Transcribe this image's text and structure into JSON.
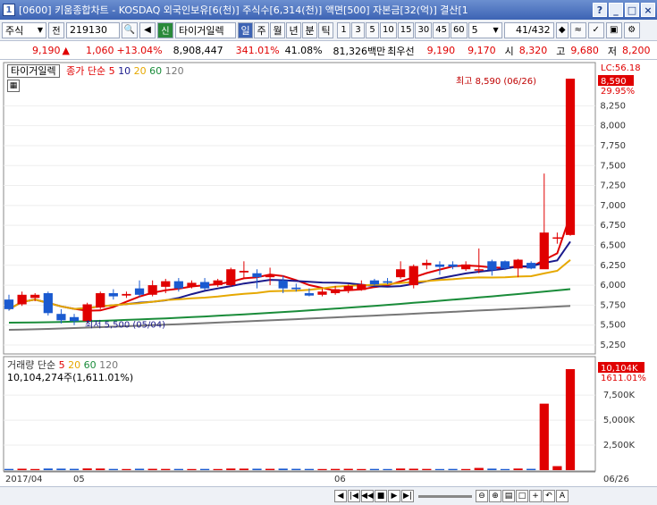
{
  "window": {
    "screen_no": "1",
    "title": "[0600] 키움종합차트 - KOSDAQ 외국인보유[6(천)] 주식수[6,314(천)] 액면[500] 자본금[32(억)] 결산[1",
    "help_label": "?",
    "minimize_label": "_",
    "maximize_label": "□",
    "close_label": "×"
  },
  "toolbar": {
    "market": "주식",
    "before_label": "전",
    "code": "219130",
    "stock_badge": "신",
    "stock_name": "타이거일렉",
    "periods": [
      "일",
      "주",
      "월",
      "년",
      "분",
      "틱"
    ],
    "active_period": "일",
    "intervals": [
      "1",
      "3",
      "5",
      "10",
      "15",
      "30",
      "45",
      "60"
    ],
    "count": "5",
    "page": "41",
    "page_total": "/432"
  },
  "quote": {
    "price": "9,190",
    "change_arrow": "▲",
    "change": "1,060",
    "change_pct": "+13.04%",
    "volume": "8,908,447",
    "vol_ratio": "341.01%",
    "turnover": "41.08%",
    "amount": "81,326백만",
    "seller": "최우선",
    "ask": "9,190",
    "bid": "9,170",
    "open_label": "시",
    "open": "8,320",
    "high_label": "고",
    "high": "9,680",
    "low_label": "저",
    "low": "8,200"
  },
  "price_panel": {
    "name_box": "타이거일렉",
    "ma_label": "종가 단순",
    "ma_periods": [
      "5",
      "10",
      "20",
      "60",
      "120"
    ],
    "ma_colors": [
      "#e00000",
      "#1a1a8c",
      "#e6a800",
      "#1a8c3a",
      "#777777"
    ],
    "high_annotation": "최고 8,590 (06/26)",
    "low_annotation": "최저 5,500 (05/04)",
    "current_tag": "8,590",
    "pct_tag": "29.95%",
    "lc_tag": "LC:56.18",
    "y_ticks": [
      "8,250",
      "8,000",
      "7,750",
      "7,500",
      "7,250",
      "7,000",
      "6,750",
      "6,500",
      "6,250",
      "6,000",
      "5,750",
      "5,500",
      "5,250"
    ]
  },
  "volume_panel": {
    "label": "거래량 단순",
    "ma_periods": [
      "5",
      "20",
      "60",
      "120"
    ],
    "value_text": "10,104,274주(1,611.01%)",
    "current_tag": "10,104K",
    "pct_tag": "1611.01%",
    "y_ticks": [
      "7,500K",
      "5,000K",
      "2,500K"
    ]
  },
  "x_axis": {
    "labels": [
      "2017/04",
      "05",
      "06",
      "06/26"
    ]
  },
  "chart_data": {
    "type": "candlestick",
    "title": "",
    "ylim": [
      5250,
      8590
    ],
    "candles": [
      {
        "o": 5820,
        "c": 5700,
        "h": 5880,
        "l": 5680
      },
      {
        "o": 5760,
        "c": 5880,
        "h": 5920,
        "l": 5740
      },
      {
        "o": 5840,
        "c": 5880,
        "h": 5900,
        "l": 5800
      },
      {
        "o": 5900,
        "c": 5650,
        "h": 5920,
        "l": 5620
      },
      {
        "o": 5640,
        "c": 5560,
        "h": 5700,
        "l": 5520
      },
      {
        "o": 5600,
        "c": 5550,
        "h": 5640,
        "l": 5500
      },
      {
        "o": 5550,
        "c": 5760,
        "h": 5780,
        "l": 5530
      },
      {
        "o": 5720,
        "c": 5900,
        "h": 5920,
        "l": 5700
      },
      {
        "o": 5900,
        "c": 5860,
        "h": 5950,
        "l": 5820
      },
      {
        "o": 5870,
        "c": 5890,
        "h": 5920,
        "l": 5840
      },
      {
        "o": 5960,
        "c": 5880,
        "h": 6060,
        "l": 5850
      },
      {
        "o": 5880,
        "c": 6000,
        "h": 6060,
        "l": 5860
      },
      {
        "o": 5980,
        "c": 6050,
        "h": 6080,
        "l": 5900
      },
      {
        "o": 6050,
        "c": 5960,
        "h": 6090,
        "l": 5920
      },
      {
        "o": 5980,
        "c": 6030,
        "h": 6060,
        "l": 5960
      },
      {
        "o": 6040,
        "c": 5960,
        "h": 6090,
        "l": 5940
      },
      {
        "o": 6000,
        "c": 6060,
        "h": 6080,
        "l": 5980
      },
      {
        "o": 6000,
        "c": 6200,
        "h": 6220,
        "l": 5980
      },
      {
        "o": 6160,
        "c": 6180,
        "h": 6300,
        "l": 6080
      },
      {
        "o": 6150,
        "c": 6100,
        "h": 6200,
        "l": 5960
      },
      {
        "o": 6100,
        "c": 6130,
        "h": 6220,
        "l": 6000
      },
      {
        "o": 6060,
        "c": 5960,
        "h": 6120,
        "l": 5900
      },
      {
        "o": 5970,
        "c": 5950,
        "h": 6020,
        "l": 5920
      },
      {
        "o": 5900,
        "c": 5870,
        "h": 5960,
        "l": 5860
      },
      {
        "o": 5880,
        "c": 5920,
        "h": 5960,
        "l": 5860
      },
      {
        "o": 5900,
        "c": 5950,
        "h": 5990,
        "l": 5880
      },
      {
        "o": 5930,
        "c": 5990,
        "h": 6010,
        "l": 5900
      },
      {
        "o": 5940,
        "c": 6010,
        "h": 6060,
        "l": 5930
      },
      {
        "o": 6060,
        "c": 6010,
        "h": 6080,
        "l": 5990
      },
      {
        "o": 6050,
        "c": 6030,
        "h": 6090,
        "l": 6010
      },
      {
        "o": 6100,
        "c": 6200,
        "h": 6300,
        "l": 6080
      },
      {
        "o": 6000,
        "c": 6240,
        "h": 6260,
        "l": 5960
      },
      {
        "o": 6250,
        "c": 6280,
        "h": 6320,
        "l": 6200
      },
      {
        "o": 6260,
        "c": 6230,
        "h": 6300,
        "l": 6130
      },
      {
        "o": 6260,
        "c": 6230,
        "h": 6300,
        "l": 6200
      },
      {
        "o": 6200,
        "c": 6260,
        "h": 6300,
        "l": 6180
      },
      {
        "o": 6200,
        "c": 6200,
        "h": 6460,
        "l": 6150
      },
      {
        "o": 6300,
        "c": 6190,
        "h": 6320,
        "l": 6120
      },
      {
        "o": 6300,
        "c": 6210,
        "h": 6310,
        "l": 6190
      },
      {
        "o": 6210,
        "c": 6320,
        "h": 6330,
        "l": 6100
      },
      {
        "o": 6280,
        "c": 6210,
        "h": 6300,
        "l": 6200
      },
      {
        "o": 6200,
        "c": 6660,
        "h": 7400,
        "l": 6220
      },
      {
        "o": 6600,
        "c": 6600,
        "h": 6660,
        "l": 6520
      },
      {
        "o": 6630,
        "c": 8590,
        "h": 8590,
        "l": 6620
      }
    ],
    "volume_k": [
      120,
      140,
      110,
      160,
      150,
      130,
      170,
      160,
      120,
      110,
      140,
      130,
      120,
      120,
      110,
      120,
      110,
      160,
      150,
      140,
      130,
      150,
      130,
      120,
      110,
      120,
      130,
      110,
      120,
      110,
      160,
      140,
      120,
      110,
      120,
      110,
      220,
      150,
      110,
      160,
      130,
      6650,
      400,
      10104
    ]
  }
}
